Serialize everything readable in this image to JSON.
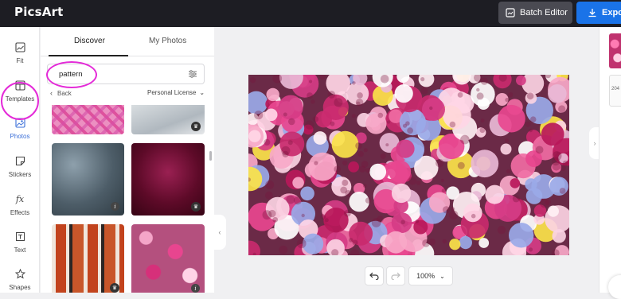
{
  "app": {
    "logo": "PicsArt"
  },
  "topbar": {
    "batch_label": "Batch Editor",
    "export_label": "Expo"
  },
  "nav": [
    {
      "label": "Fit",
      "icon": "image-fit-icon"
    },
    {
      "label": "Templates",
      "icon": "templates-icon"
    },
    {
      "label": "Photos",
      "icon": "photos-icon"
    },
    {
      "label": "Stickers",
      "icon": "stickers-icon"
    },
    {
      "label": "Effects",
      "icon": "fx-icon"
    },
    {
      "label": "Text",
      "icon": "text-icon"
    },
    {
      "label": "Shapes",
      "icon": "star-icon"
    }
  ],
  "panel": {
    "tabs": [
      "Discover",
      "My Photos"
    ],
    "active_tab": "Discover",
    "search": {
      "value": "pattern"
    },
    "back_label": "Back",
    "license_label": "Personal License"
  },
  "zoom": {
    "value": "100%"
  },
  "right_panel": {
    "card_label": "204"
  },
  "colors": {
    "accent": "#1a73e8",
    "highlight": "#e42bd8",
    "topbar": "#1d1d23"
  },
  "fx_glyph": "fx"
}
